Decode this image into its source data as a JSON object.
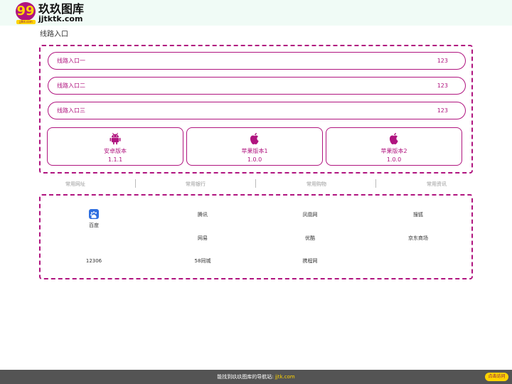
{
  "brand": {
    "logo_number": "99",
    "logo_domain": "jjtkk.com",
    "name": "玖玖图库",
    "domain": "jjtktk.com",
    "accent_color": "#b0147f",
    "badge_color": "#ffd400"
  },
  "routes_section": {
    "title": "线路入口",
    "routes": [
      {
        "label": "线路入口一",
        "ping": "123"
      },
      {
        "label": "线路入口二",
        "ping": "123"
      },
      {
        "label": "线路入口三",
        "ping": "123"
      }
    ],
    "apps": [
      {
        "icon": "android-icon",
        "name": "安卓版本",
        "version": "1.1.1"
      },
      {
        "icon": "apple-icon",
        "name": "苹果版本1",
        "version": "1.0.0"
      },
      {
        "icon": "apple-icon",
        "name": "苹果版本2",
        "version": "1.0.0"
      }
    ]
  },
  "categories": [
    "常用网址",
    "常用银行",
    "常用购物",
    "常用资讯"
  ],
  "links": {
    "row1": [
      "百度",
      "腾讯",
      "凤凰网",
      "搜狐"
    ],
    "row2": [
      "网易",
      "优酷",
      "京东商场"
    ],
    "row3": [
      "12306",
      "58同城",
      "携程网"
    ]
  },
  "footer": {
    "text": "能找到玖玖图库的导航站:",
    "link": "jjtk.com",
    "button": "点击访问"
  }
}
